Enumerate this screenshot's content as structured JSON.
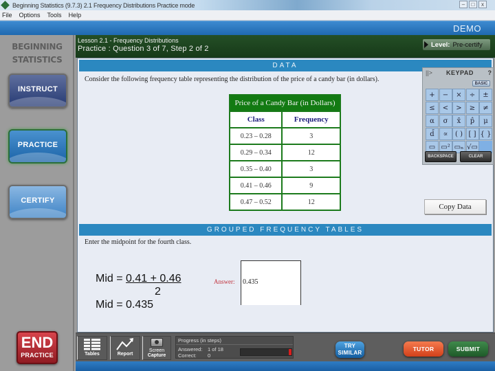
{
  "window": {
    "title": "Beginning Statistics (9.7.3)   2.1 Frequency Distributions     Practice mode",
    "controls": [
      "minimize",
      "maximize",
      "close"
    ]
  },
  "menu": [
    "File",
    "Options",
    "Tools",
    "Help"
  ],
  "header": {
    "badge": "DEMO"
  },
  "sidebar": {
    "logo_line1": "BEGINNING",
    "logo_line2": "STATISTICS",
    "nav": [
      {
        "label": "INSTRUCT",
        "active": false
      },
      {
        "label": "PRACTICE",
        "active": true
      },
      {
        "label": "CERTIFY",
        "active": false
      }
    ],
    "end_big": "END",
    "end_small": "PRACTICE"
  },
  "lesson": {
    "title": "Lesson 2.1 - Frequency Distributions",
    "subtitle": "Practice : Question 3 of 7, Step 2 of 2",
    "level_label": "Level:",
    "level_value": "Pre-certify"
  },
  "data_section": {
    "heading": "DATA",
    "prompt": "Consider the following frequency table representing the distribution of the price of a candy bar (in dollars).",
    "table": {
      "caption": "Price of a Candy Bar (in Dollars)",
      "headers": [
        "Class",
        "Frequency"
      ],
      "rows": [
        [
          "0.23 – 0.28",
          "3"
        ],
        [
          "0.29 – 0.34",
          "12"
        ],
        [
          "0.35 – 0.40",
          "3"
        ],
        [
          "0.41 – 0.46",
          "9"
        ],
        [
          "0.47 – 0.52",
          "12"
        ]
      ]
    }
  },
  "keypad": {
    "grip": "||>",
    "title": "KEYPAD",
    "help": "?",
    "mode": "BASIC",
    "keys": [
      "+",
      "−",
      "×",
      "÷",
      "±",
      "≤",
      "<",
      ">",
      "≥",
      "≠",
      "α",
      "σ",
      "x̄",
      "p̂",
      "μ",
      "d̄",
      "∝",
      "( )",
      "[ ]",
      "{ }",
      "fraction",
      "superscript",
      "subscript",
      "sqrt",
      ""
    ],
    "key_glyphs": [
      "+",
      "−",
      "×",
      "÷",
      "±",
      "≤",
      "<",
      ">",
      "≥",
      "≠",
      "α",
      "σ",
      "x̄",
      "p̂",
      "μ",
      "d̄",
      "∝",
      "( )",
      "[ ]",
      "{ }",
      "▭",
      "▭²",
      "▭ₙ",
      "√▭",
      ""
    ],
    "backspace": "BACKSPACE",
    "clear": "CLEAR"
  },
  "copy_data": "Copy Data",
  "grouped_section": {
    "heading": "GROUPED FREQUENCY TABLES",
    "prompt": "Enter the midpoint for the fourth class.",
    "formula_prefix": "Mid = ",
    "formula_numerator": "0.41 + 0.46",
    "formula_denominator": "2",
    "formula_result": "Mid = 0.435",
    "answer_label": "Answer:",
    "answer_value": "0.435"
  },
  "toolbar": {
    "tables": "Tables",
    "report": "Report",
    "capture_line1": "Screen",
    "capture_line2": "Capture",
    "progress_title": "Progress (in steps)",
    "answered_label": "Answered:",
    "answered_value": "1 of 18",
    "correct_label": "Correct:",
    "correct_value": "0",
    "progress_fraction": 0.0556,
    "try_line1": "TRY",
    "try_line2": "SIMILAR",
    "tutor": "TUTOR",
    "submit": "SUBMIT"
  }
}
